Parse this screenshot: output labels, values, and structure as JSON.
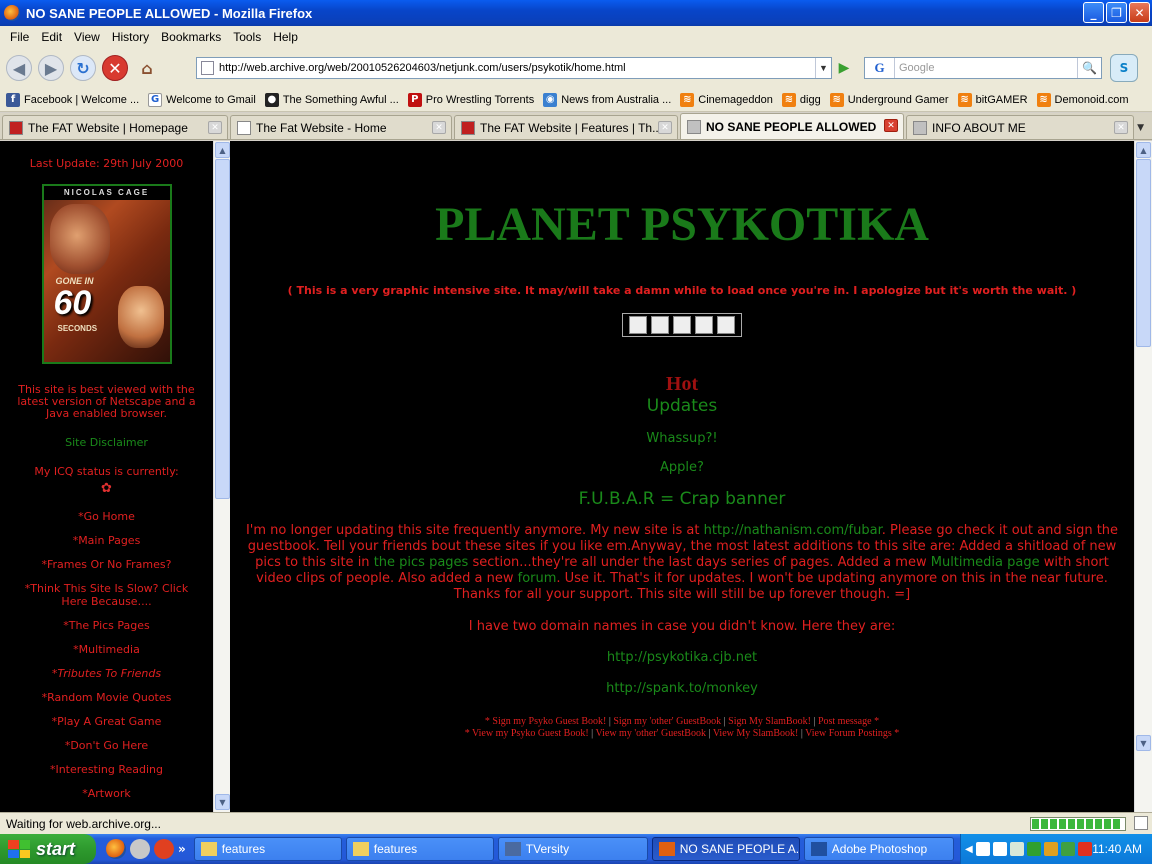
{
  "window": {
    "title": "NO SANE PEOPLE ALLOWED - Mozilla Firefox"
  },
  "menu": [
    "File",
    "Edit",
    "View",
    "History",
    "Bookmarks",
    "Tools",
    "Help"
  ],
  "address": {
    "url": "http://web.archive.org/web/20010526204603/netjunk.com/users/psykotik/home.html"
  },
  "search": {
    "engine_glyph": "G",
    "placeholder": "Google"
  },
  "bookmarks": [
    {
      "label": "Facebook | Welcome ...",
      "color": "#3b5998",
      "glyph": "f"
    },
    {
      "label": "Welcome to Gmail",
      "color": "#ffffff",
      "glyph": "G"
    },
    {
      "label": "The Something Awful ...",
      "color": "#222222",
      "glyph": "●"
    },
    {
      "label": "Pro Wrestling Torrents",
      "color": "#c01010",
      "glyph": "P"
    },
    {
      "label": "News from Australia ...",
      "color": "#3a80d0",
      "glyph": "◉"
    },
    {
      "label": "Cinemageddon",
      "color": "#f08010",
      "glyph": "≋"
    },
    {
      "label": "digg",
      "color": "#f08010",
      "glyph": "≋"
    },
    {
      "label": "Underground Gamer",
      "color": "#f08010",
      "glyph": "≋"
    },
    {
      "label": "bitGAMER",
      "color": "#f08010",
      "glyph": "≋"
    },
    {
      "label": "Demonoid.com",
      "color": "#f08010",
      "glyph": "≋"
    }
  ],
  "tabs": [
    {
      "label": "The FAT Website | Homepage",
      "active": false
    },
    {
      "label": "The Fat Website - Home",
      "active": false
    },
    {
      "label": "The FAT Website | Features | Th...",
      "active": false
    },
    {
      "label": "NO SANE PEOPLE ALLOWED",
      "active": true
    },
    {
      "label": "INFO ABOUT ME",
      "active": false
    }
  ],
  "sidebar": {
    "last_update": "Last Update: 29th July 2000",
    "poster": {
      "top": "NICOLAS CAGE",
      "title": "GONE IN",
      "number": "60",
      "sub": "SECONDS"
    },
    "best_viewed": "This site is best viewed with the latest version of Netscape and a Java enabled browser.",
    "disclaimer": "Site Disclaimer",
    "icq": "My ICQ status is currently:",
    "nav": [
      {
        "label": "Go Home",
        "italic": false
      },
      {
        "label": "Main Pages",
        "italic": false
      },
      {
        "label": "Frames Or No Frames?",
        "italic": false
      },
      {
        "label": "Think This Site Is Slow? Click Here Because....",
        "italic": false
      },
      {
        "label": "The Pics Pages",
        "italic": false
      },
      {
        "label": "Multimedia",
        "italic": false
      },
      {
        "label": "Tributes To Friends",
        "italic": true
      },
      {
        "label": "Random Movie Quotes",
        "italic": false
      },
      {
        "label": "Play A Great Game",
        "italic": false
      },
      {
        "label": "Don't Go Here",
        "italic": false
      },
      {
        "label": "Interesting Reading",
        "italic": false
      },
      {
        "label": "Artwork",
        "italic": false
      }
    ]
  },
  "main": {
    "heading": "PLANET PSYKOTIKA",
    "warning": "( This is a very graphic intensive site. It may/will take a damn while to load once you're in. I apologize but it's worth the wait. )",
    "hot": "Hot",
    "updates": "Updates",
    "whassup": "Whassup?!",
    "apple": "Apple?",
    "fubar": "F.U.B.A.R = Crap banner",
    "para_1": "I'm no longer updating this site frequently anymore. My new site is at ",
    "para_link1": "http://nathanism.com/fubar",
    "para_2": ". Please go check it out and sign the guestbook. Tell your friends bout these sites if you like em.Anyway, the most latest additions to this site are: Added a shitload of new pics to this site in ",
    "para_link2": "the pics pages",
    "para_3": " section...they're all under the last days series of pages. Added a mew ",
    "para_link3": "Multimedia page",
    "para_4": " with short video clips of people. Also added a new ",
    "para_link4": "forum",
    "para_5": ". Use it. That's it for updates. I won't be updating anymore on this in the near future. Thanks for all your support. This site will still be up forever though. =]",
    "domains_intro": "I have two domain names in case you didn't know. Here they are:",
    "domain_1": "http://psykotika.cjb.net",
    "domain_2": "http://spank.to/monkey",
    "footer_row1": [
      "Sign my Psyko Guest Book!",
      "Sign my 'other' GuestBook",
      "Sign My SlamBook!",
      "Post message"
    ],
    "footer_row2": [
      "View my Psyko Guest Book!",
      "View my 'other' GuestBook",
      "View My SlamBook!",
      "View Forum Postings"
    ]
  },
  "status": {
    "text": "Waiting for web.archive.org..."
  },
  "taskbar": {
    "start": "start",
    "tasks": [
      {
        "label": "features",
        "active": false
      },
      {
        "label": "features",
        "active": false
      },
      {
        "label": "TVersity",
        "active": false
      },
      {
        "label": "NO SANE PEOPLE A...",
        "active": true
      },
      {
        "label": "Adobe Photoshop",
        "active": false
      }
    ],
    "clock": "11:40 AM"
  },
  "colors": {
    "accent_red": "#e02020",
    "accent_green": "#1a8a1a"
  }
}
